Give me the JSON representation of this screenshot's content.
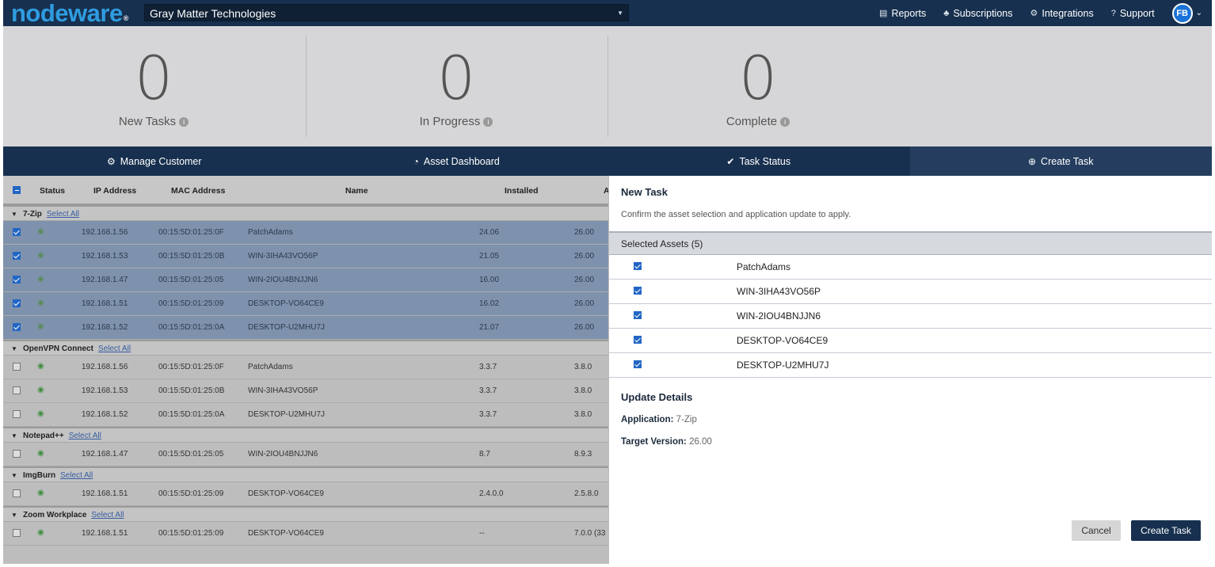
{
  "header": {
    "logo": "nodeware",
    "logo_mark": "®",
    "org": "Gray Matter Technologies",
    "nav": [
      "Reports",
      "Subscriptions",
      "Integrations",
      "Support"
    ],
    "avatar": "FB"
  },
  "stats": [
    {
      "value": "0",
      "label": "New Tasks"
    },
    {
      "value": "0",
      "label": "In Progress"
    },
    {
      "value": "0",
      "label": "Complete"
    }
  ],
  "tabs": [
    {
      "label": "Manage Customer",
      "icon": "gear-icon"
    },
    {
      "label": "Asset Dashboard",
      "icon": "gauge-icon"
    },
    {
      "label": "Task Status",
      "icon": "check-circle-icon"
    },
    {
      "label": "Create Task",
      "icon": "plus-circle-icon",
      "active": true
    }
  ],
  "table": {
    "headers": [
      "Status",
      "IP Address",
      "MAC Address",
      "Name",
      "Installed",
      "A"
    ],
    "select_all_label": "Select All",
    "groups": [
      {
        "name": "7-Zip",
        "rows": [
          {
            "checked": true,
            "ip": "192.168.1.56",
            "mac": "00:15:5D:01:25:0F",
            "name": "PatchAdams",
            "installed": "24.06",
            "available": "26.00"
          },
          {
            "checked": true,
            "ip": "192.168.1.53",
            "mac": "00:15:5D:01:25:0B",
            "name": "WIN-3IHA43VO56P",
            "installed": "21.05",
            "available": "26.00"
          },
          {
            "checked": true,
            "ip": "192.168.1.47",
            "mac": "00:15:5D:01:25:05",
            "name": "WIN-2IOU4BNJJN6",
            "installed": "16.00",
            "available": "26.00"
          },
          {
            "checked": true,
            "ip": "192.168.1.51",
            "mac": "00:15:5D:01:25:09",
            "name": "DESKTOP-VO64CE9",
            "installed": "16.02",
            "available": "26.00"
          },
          {
            "checked": true,
            "ip": "192.168.1.52",
            "mac": "00:15:5D:01:25:0A",
            "name": "DESKTOP-U2MHU7J",
            "installed": "21.07",
            "available": "26.00"
          }
        ]
      },
      {
        "name": "OpenVPN Connect",
        "rows": [
          {
            "checked": false,
            "ip": "192.168.1.56",
            "mac": "00:15:5D:01:25:0F",
            "name": "PatchAdams",
            "installed": "3.3.7",
            "available": "3.8.0"
          },
          {
            "checked": false,
            "ip": "192.168.1.53",
            "mac": "00:15:5D:01:25:0B",
            "name": "WIN-3IHA43VO56P",
            "installed": "3.3.7",
            "available": "3.8.0"
          },
          {
            "checked": false,
            "ip": "192.168.1.52",
            "mac": "00:15:5D:01:25:0A",
            "name": "DESKTOP-U2MHU7J",
            "installed": "3.3.7",
            "available": "3.8.0"
          }
        ]
      },
      {
        "name": "Notepad++",
        "rows": [
          {
            "checked": false,
            "ip": "192.168.1.47",
            "mac": "00:15:5D:01:25:05",
            "name": "WIN-2IOU4BNJJN6",
            "installed": "8.7",
            "available": "8.9.3"
          }
        ]
      },
      {
        "name": "ImgBurn",
        "rows": [
          {
            "checked": false,
            "ip": "192.168.1.51",
            "mac": "00:15:5D:01:25:09",
            "name": "DESKTOP-VO64CE9",
            "installed": "2.4.0.0",
            "available": "2.5.8.0"
          }
        ]
      },
      {
        "name": "Zoom Workplace",
        "rows": [
          {
            "checked": false,
            "ip": "192.168.1.51",
            "mac": "00:15:5D:01:25:09",
            "name": "DESKTOP-VO64CE9",
            "installed": "--",
            "available": "7.0.0 (33"
          }
        ]
      }
    ]
  },
  "task": {
    "title": "New Task",
    "subtitle": "Confirm the asset selection and application update to apply.",
    "selected_header": "Selected Assets (5)",
    "selected_assets": [
      "PatchAdams",
      "WIN-3IHA43VO56P",
      "WIN-2IOU4BNJJN6",
      "DESKTOP-VO64CE9",
      "DESKTOP-U2MHU7J"
    ],
    "update_title": "Update Details",
    "application_label": "Application:",
    "application": "7-Zip",
    "target_label": "Target Version:",
    "target": "26.00",
    "cancel_label": "Cancel",
    "create_label": "Create Task"
  }
}
